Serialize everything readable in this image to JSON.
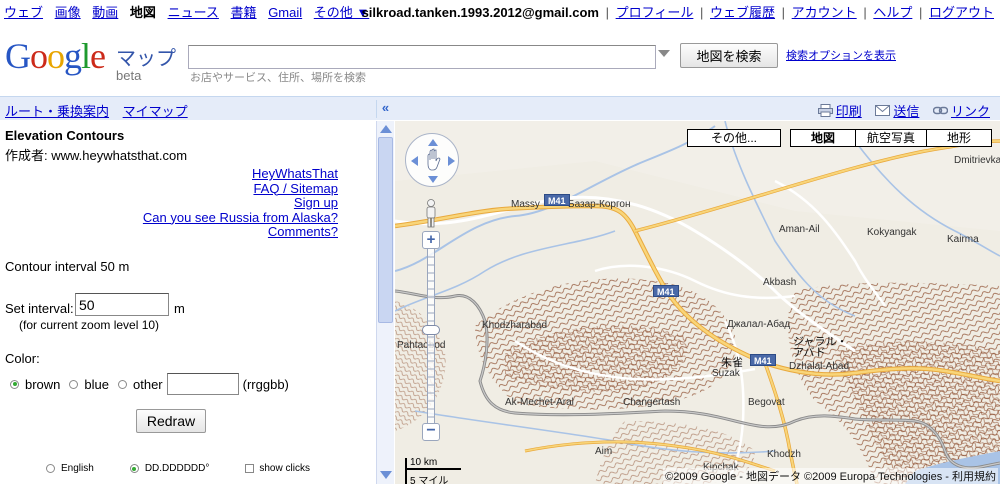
{
  "topnav": {
    "items": [
      "ウェブ",
      "画像",
      "動画",
      "地図",
      "ニュース",
      "書籍",
      "Gmail"
    ],
    "current": "地図",
    "more": "その他 ▼"
  },
  "usernav": {
    "email": "silkroad.tanken.1993.2012@gmail.com",
    "links": [
      "プロフィール",
      "ウェブ履歴",
      "アカウント",
      "ヘルプ",
      "ログアウト"
    ]
  },
  "header": {
    "logo_letters": [
      "G",
      "o",
      "o",
      "g",
      "l",
      "e"
    ],
    "product": "マップ",
    "beta": "beta",
    "search_value": "",
    "search_hint": "お店やサービス、住所、場所を検索",
    "search_button": "地図を検索",
    "search_options": "検索オプションを表示"
  },
  "linkbar": {
    "left_links": [
      "ルート・乗換案内",
      "マイマップ"
    ],
    "collapse": "«",
    "print": "印刷",
    "send": "送信",
    "link": "リンク"
  },
  "panel": {
    "title": "Elevation Contours",
    "author": "作成者: www.heywhatsthat.com",
    "links": [
      "HeyWhatsThat",
      "FAQ / Sitemap",
      "Sign up",
      "Can you see Russia from Alaska?",
      "Comments?"
    ],
    "contour_interval": "Contour interval 50 m",
    "set_interval_label": "Set interval:",
    "interval_value": "50",
    "interval_unit": "m",
    "zoom_note": "(for current zoom level 10)",
    "color_label": "Color:",
    "color_options": [
      "brown",
      "blue",
      "other"
    ],
    "color_selected": "brown",
    "color_input_value": "",
    "color_hint": "(rrggbb)",
    "redraw": "Redraw",
    "bottom_options": {
      "english": "English",
      "coord_format": "DD.DDDDDD°",
      "show_clicks": "show clicks"
    }
  },
  "map": {
    "types": {
      "more": "その他...",
      "map": "地図",
      "satellite": "航空写真",
      "terrain": "地形",
      "selected": "地図"
    },
    "places": {
      "massy": "Massy",
      "bazar_korgon": "Базар-Коргон",
      "dmitrievka": "Dmitrievka",
      "aman_ail": "Aman-Ail",
      "kokyangak": "Kokyangak",
      "kairma": "Kairma",
      "akbash": "Akbash",
      "dzhalal_abad_ru": "Джалал-Абад",
      "khodzharabad": "Khodzharabad",
      "pahtaobod": "Pahtaobod",
      "zhalal_abad_jp": "ジャラル・\nアバド",
      "suzak_jp": "朱雀",
      "suzak": "Suzak",
      "dzhalal_abad": "Dzhalal-Abad",
      "ak_mechet_aral": "Ak-Mechet-Aral",
      "changertash": "Changertash",
      "begovat": "Begovat",
      "aim": "Aim",
      "kipchak": "Kipchak",
      "khodzh": "Khodzh"
    },
    "shields": [
      "M41",
      "M41",
      "M41"
    ],
    "scale_km": "10 km",
    "scale_mi": "5 マイル",
    "copyright": "©2009 Google - 地図データ ©2009 Europa Technologies - 利用規約"
  },
  "colors": {
    "link": "#0000cc",
    "linkbar_bg": "#e5ecf9",
    "contour": "#8b4a2b",
    "road_major": "#f4c05a",
    "river": "#a9c3e6"
  }
}
